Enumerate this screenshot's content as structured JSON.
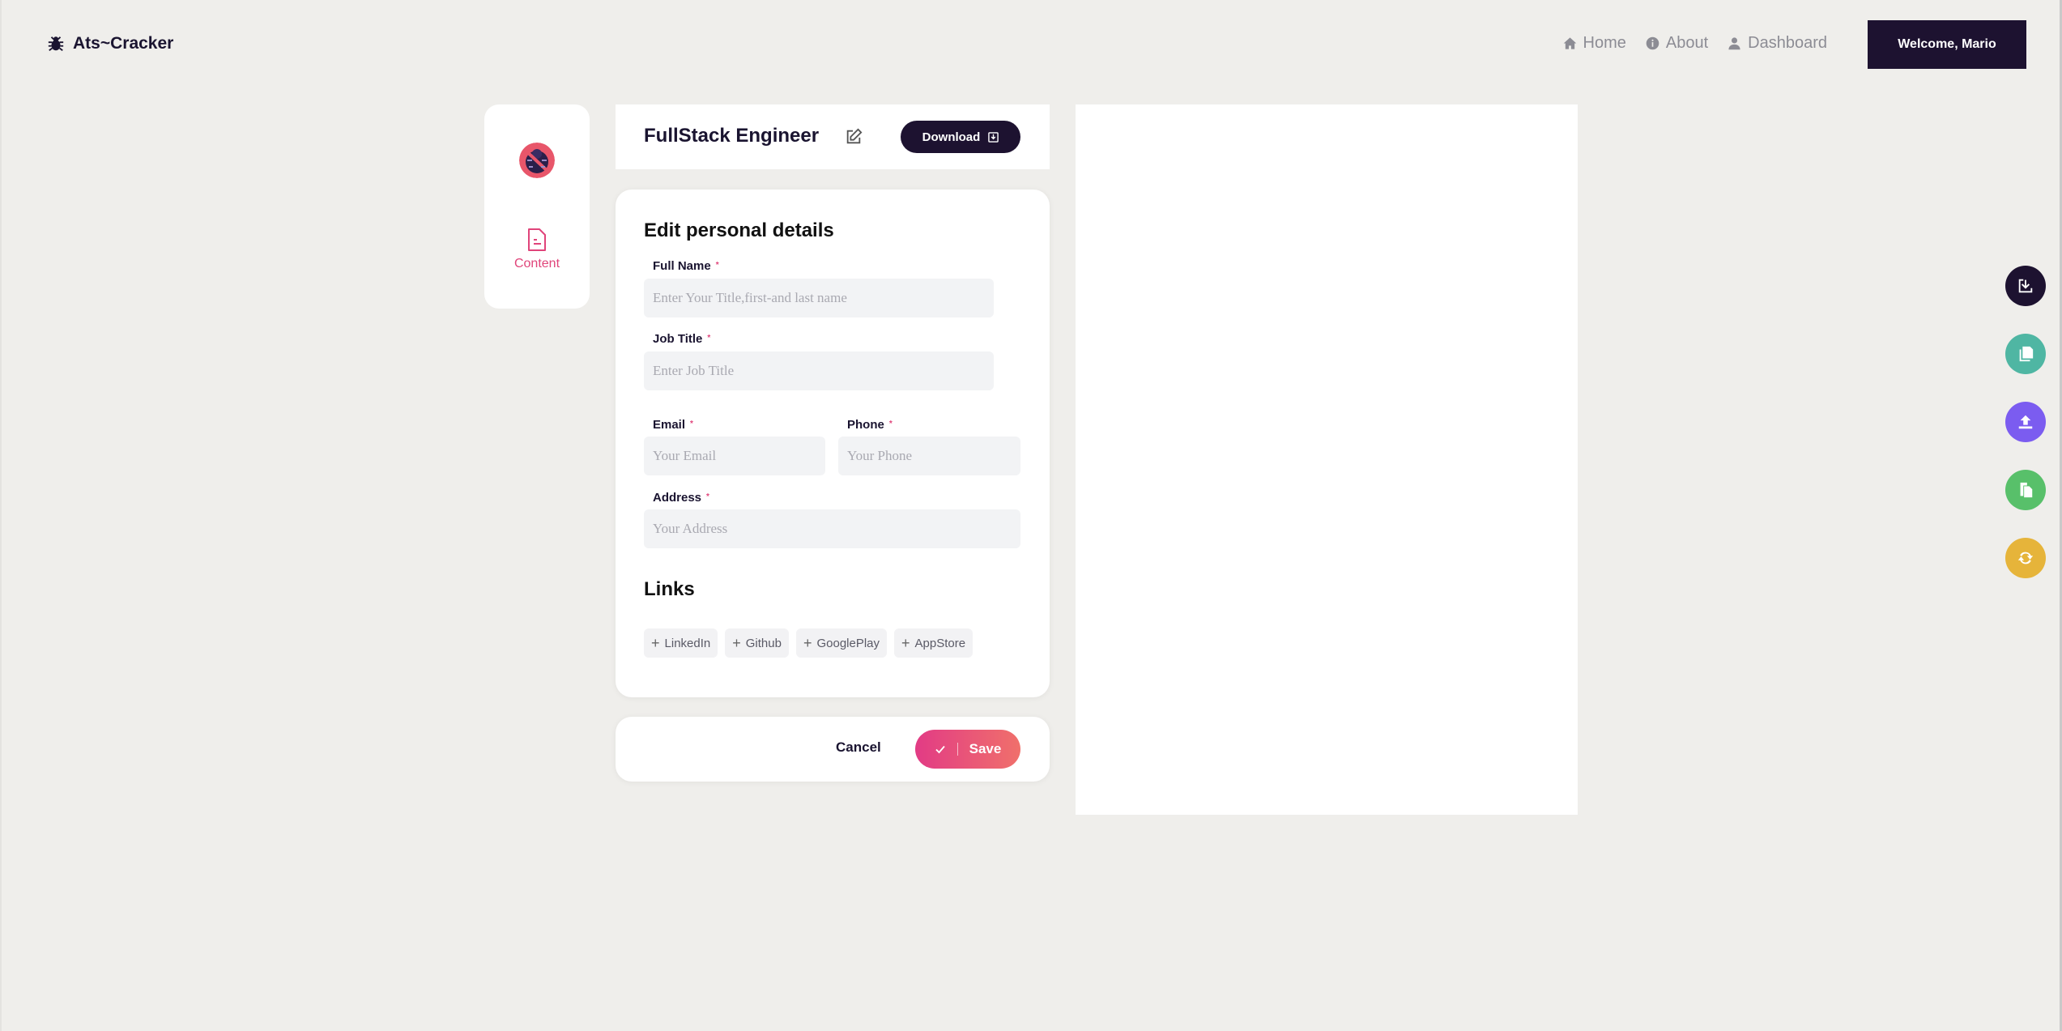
{
  "brand": {
    "name": "Ats~Cracker",
    "icon": "bug-icon"
  },
  "nav": {
    "items": [
      {
        "label": "Home",
        "icon": "home-icon"
      },
      {
        "label": "About",
        "icon": "info-icon"
      },
      {
        "label": "Dashboard",
        "icon": "user-icon"
      }
    ],
    "welcome": "Welcome, Mario"
  },
  "sidebar": {
    "content_label": "Content"
  },
  "editor": {
    "doc_title": "FullStack Engineer",
    "download_label": "Download",
    "personal": {
      "heading": "Edit personal details",
      "full_name": {
        "label": "Full Name",
        "placeholder": "Enter Your Title,first-and last name",
        "value": ""
      },
      "job_title": {
        "label": "Job Title",
        "placeholder": "Enter Job Title",
        "value": ""
      },
      "email": {
        "label": "Email",
        "placeholder": "Your Email",
        "value": ""
      },
      "phone": {
        "label": "Phone",
        "placeholder": "Your Phone",
        "value": ""
      },
      "address": {
        "label": "Address",
        "placeholder": "Your Address",
        "value": ""
      },
      "required_mark": "*"
    },
    "links": {
      "heading": "Links",
      "plus": "+",
      "items": [
        "LinkedIn",
        "Github",
        "GooglePlay",
        "AppStore"
      ]
    },
    "actions": {
      "cancel": "Cancel",
      "save": "Save"
    }
  },
  "fabs": [
    {
      "icon": "download-icon",
      "color": "#1d1230"
    },
    {
      "icon": "copy-icon",
      "color": "#4fb6a3"
    },
    {
      "icon": "upload-icon",
      "color": "#7b5cf0"
    },
    {
      "icon": "duplicate-icon",
      "color": "#58c06a"
    },
    {
      "icon": "refresh-icon",
      "color": "#e6b43a"
    }
  ]
}
